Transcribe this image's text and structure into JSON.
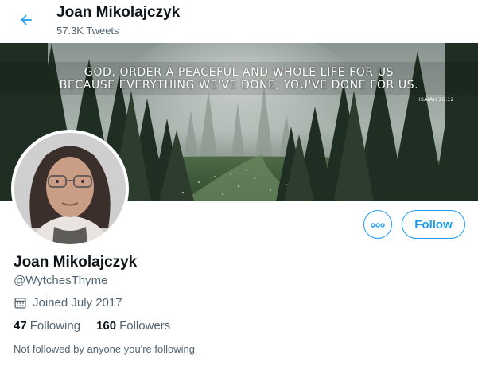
{
  "header": {
    "name": "Joan Mikolajczyk",
    "tweet_count": "57.3K Tweets"
  },
  "banner": {
    "line1": "GOD, ORDER A PEACEFUL AND WHOLE LIFE FOR US",
    "line2": "BECAUSE EVERYTHING WE'VE DONE, YOU'VE DONE FOR US.",
    "reference": "ISAIAH 26:12"
  },
  "profile": {
    "display_name": "Joan Mikolajczyk",
    "handle": "@WytchesThyme",
    "joined": "Joined July 2017",
    "following_count": "47",
    "following_label": "Following",
    "followers_count": "160",
    "followers_label": "Followers",
    "not_followed": "Not followed by anyone you're following"
  },
  "actions": {
    "follow_label": "Follow",
    "more_icon": "more-horizontal-icon"
  },
  "icons": {
    "back": "arrow-left-icon",
    "joined": "calendar-icon"
  },
  "colors": {
    "accent": "#1d9bf0",
    "text_primary": "#0f1419",
    "text_secondary": "#536471"
  }
}
